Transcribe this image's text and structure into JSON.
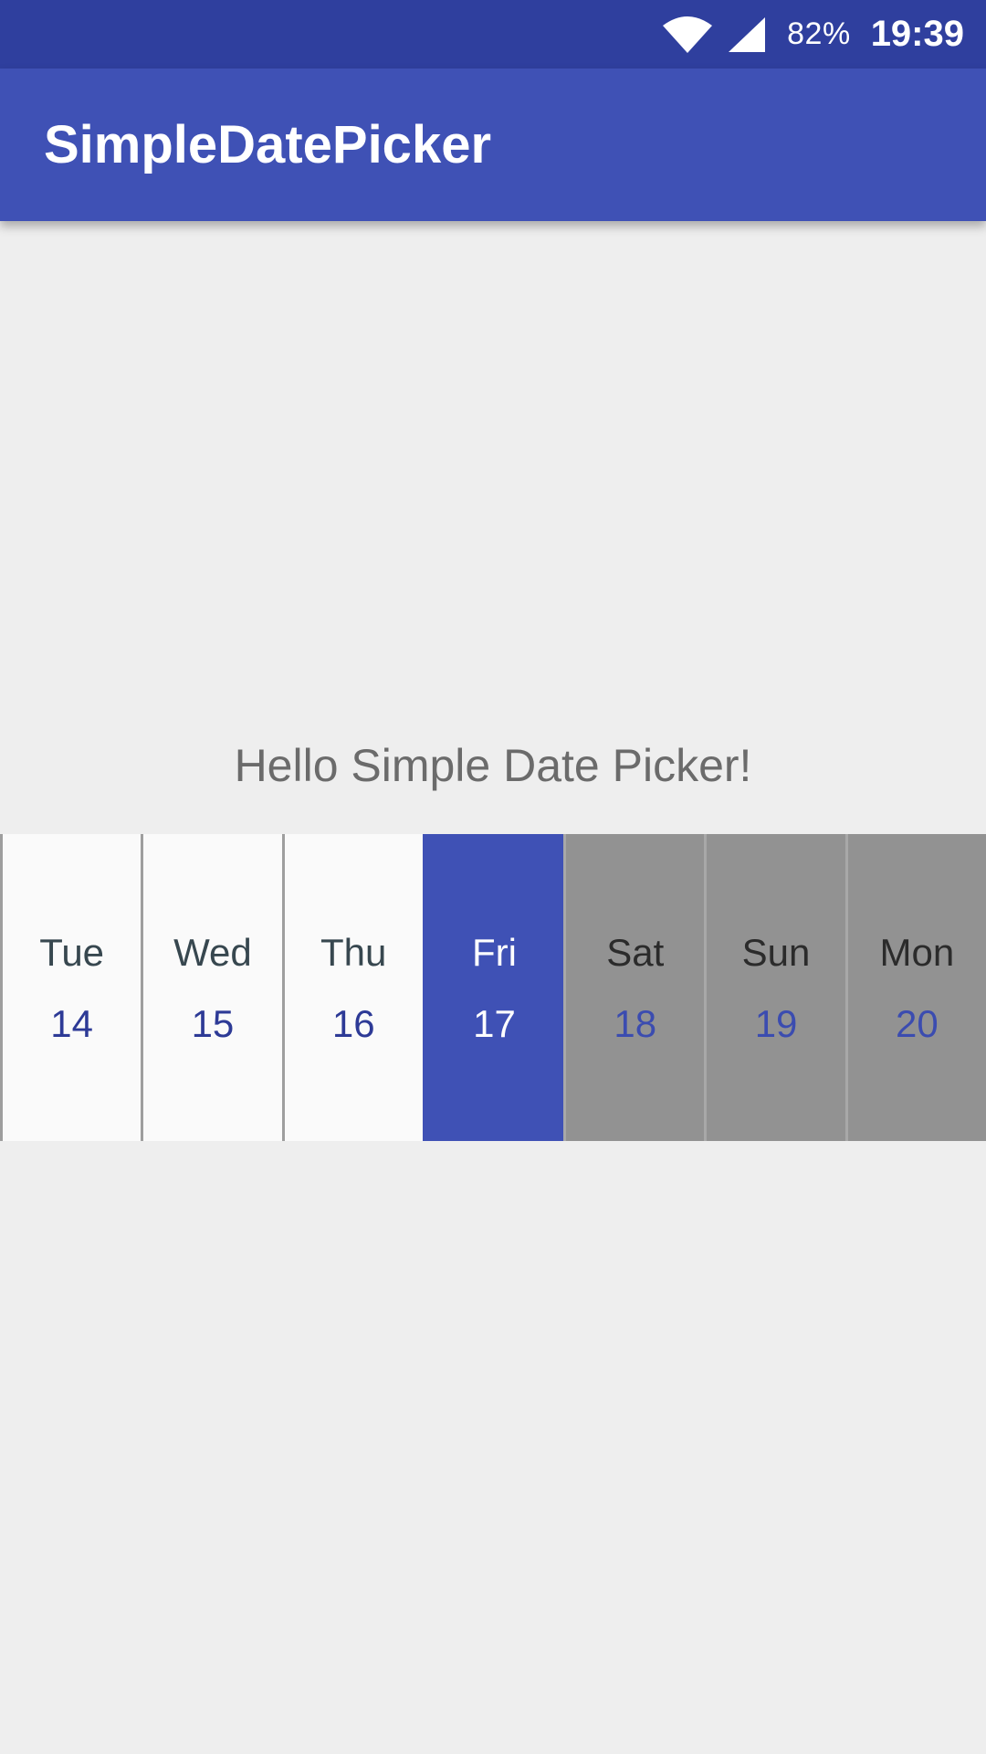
{
  "status_bar": {
    "battery": "82%",
    "time": "19:39",
    "icons": [
      "wifi-icon",
      "signal-icon"
    ]
  },
  "app_bar": {
    "title": "SimpleDatePicker"
  },
  "main": {
    "hello_text": "Hello Simple Date Picker!"
  },
  "date_picker": {
    "selected_index": 3,
    "days": [
      {
        "name": "Tue",
        "number": "14",
        "state": "past"
      },
      {
        "name": "Wed",
        "number": "15",
        "state": "past"
      },
      {
        "name": "Thu",
        "number": "16",
        "state": "past"
      },
      {
        "name": "Fri",
        "number": "17",
        "state": "selected"
      },
      {
        "name": "Sat",
        "number": "18",
        "state": "future"
      },
      {
        "name": "Sun",
        "number": "19",
        "state": "future"
      },
      {
        "name": "Mon",
        "number": "20",
        "state": "future"
      }
    ]
  },
  "colors": {
    "status_bar": "#2f3f9e",
    "primary": "#3f51b5",
    "background": "#eeeeee",
    "future_cell": "#929292"
  }
}
